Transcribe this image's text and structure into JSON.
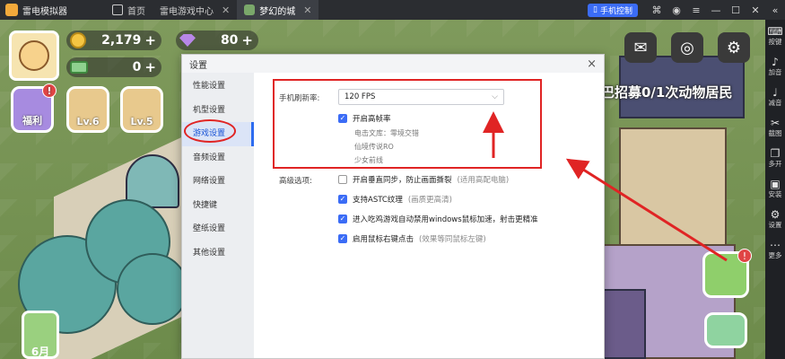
{
  "titlebar": {
    "app_name": "雷电模拟器",
    "tabs": [
      {
        "label": "首页"
      },
      {
        "label": "雷电游戏中心"
      },
      {
        "label": "梦幻的城"
      }
    ],
    "control_button": "手机控制"
  },
  "sidebar": {
    "items": [
      {
        "label": "按键",
        "icon": "keyboard-icon"
      },
      {
        "label": "加音",
        "icon": "volume-up-icon"
      },
      {
        "label": "减音",
        "icon": "volume-down-icon"
      },
      {
        "label": "截图",
        "icon": "scissors-icon"
      },
      {
        "label": "多开",
        "icon": "multi-instance-icon"
      },
      {
        "label": "安装",
        "icon": "apk-icon"
      },
      {
        "label": "设置",
        "icon": "gear-icon"
      },
      {
        "label": "更多",
        "icon": "more-icon"
      }
    ]
  },
  "game": {
    "coins": "2,179",
    "gems": "80",
    "cash": "0",
    "welfare_label": "福利",
    "lv6_label": "Lv.6",
    "lv5_label": "Lv.5",
    "badge": "!",
    "recruit_text": "巴招募0/1次动物居民",
    "month_label": "6月",
    "plus": "+"
  },
  "dialog": {
    "title": "设置",
    "close": "×",
    "nav": [
      {
        "label": "性能设置"
      },
      {
        "label": "机型设置"
      },
      {
        "label": "游戏设置",
        "active": true
      },
      {
        "label": "音频设置"
      },
      {
        "label": "网络设置"
      },
      {
        "label": "快捷键"
      },
      {
        "label": "壁纸设置"
      },
      {
        "label": "其他设置"
      }
    ],
    "refresh_label": "手机刷新率:",
    "refresh_value": "120 FPS",
    "high_fps": {
      "label": "开启高帧率",
      "checked": true
    },
    "supported_games": [
      "电击文库：零境交错",
      "仙境传说RO",
      "少女前线"
    ],
    "advanced_label": "高级选项:",
    "options": [
      {
        "label": "开启垂直同步，防止画面撕裂",
        "hint": "(适用高配电脑)",
        "checked": false
      },
      {
        "label": "支持ASTC纹理",
        "hint": "(画质更高清)",
        "checked": true
      },
      {
        "label": "进入吃鸡游戏自动禁用windows鼠标加速，射击更精准",
        "hint": "",
        "checked": true
      },
      {
        "label": "启用鼠标右键点击",
        "hint": "(效果等同鼠标左键)",
        "checked": true
      }
    ]
  },
  "colors": {
    "accent": "#3b6cf6",
    "annotation": "#e02424",
    "titlebar": "#2b2d31"
  }
}
